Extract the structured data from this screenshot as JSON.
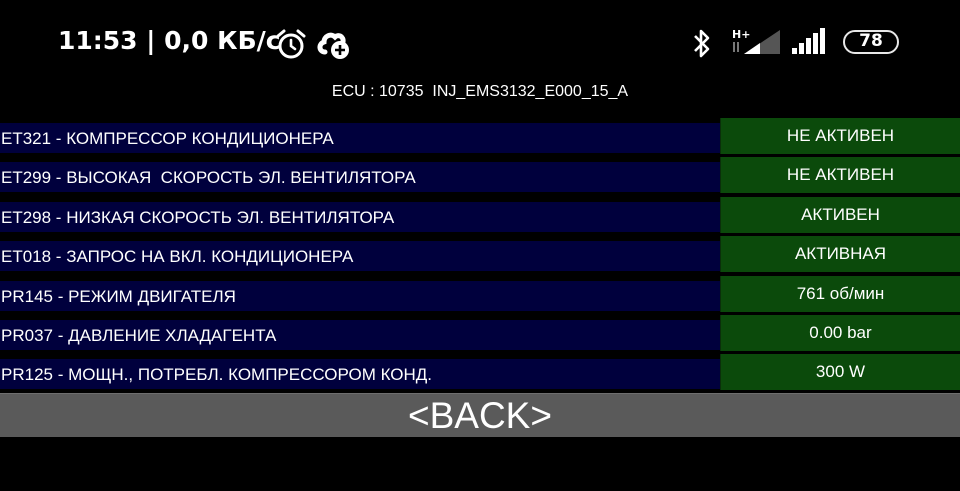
{
  "status_bar": {
    "time": "11:53",
    "separator": "|",
    "net_speed": "0,0 КБ/с",
    "network_type": "H+",
    "battery_level": "78",
    "icons": [
      "alarm-icon",
      "sync-icon",
      "bluetooth-icon",
      "signal-icon",
      "battery-icon"
    ]
  },
  "ecu": {
    "label": "ECU : 10735  INJ_EMS3132_E000_15_A"
  },
  "rows": [
    {
      "label": "ET321 - КОМПРЕССОР КОНДИЦИОНЕРА",
      "value": "НЕ АКТИВЕН"
    },
    {
      "label": "ET299 - ВЫСОКАЯ  СКОРОСТЬ ЭЛ. ВЕНТИЛЯТОРА",
      "value": "НЕ АКТИВЕН"
    },
    {
      "label": "ET298 - НИЗКАЯ СКОРОСТЬ ЭЛ. ВЕНТИЛЯТОРА",
      "value": "АКТИВЕН"
    },
    {
      "label": "ET018 - ЗАПРОС НА ВКЛ. КОНДИЦИОНЕРА",
      "value": "АКТИВНАЯ"
    },
    {
      "label": "PR145 - РЕЖИМ ДВИГАТЕЛЯ",
      "value": "761 об/мин"
    },
    {
      "label": "PR037 - ДАВЛЕНИЕ ХЛАДАГЕНТА",
      "value": "0.00 bar"
    },
    {
      "label": "PR125 - МОЩН., ПОТРЕБЛ. КОМПРЕССОРОМ КОНД.",
      "value": "300 W"
    }
  ],
  "back_button": {
    "label": "<BACK>"
  },
  "colors": {
    "background": "#000000",
    "label_background": "#00003d",
    "value_background": "#0b4a0b",
    "button_background": "#5a5a5a",
    "text": "#ffffff"
  }
}
